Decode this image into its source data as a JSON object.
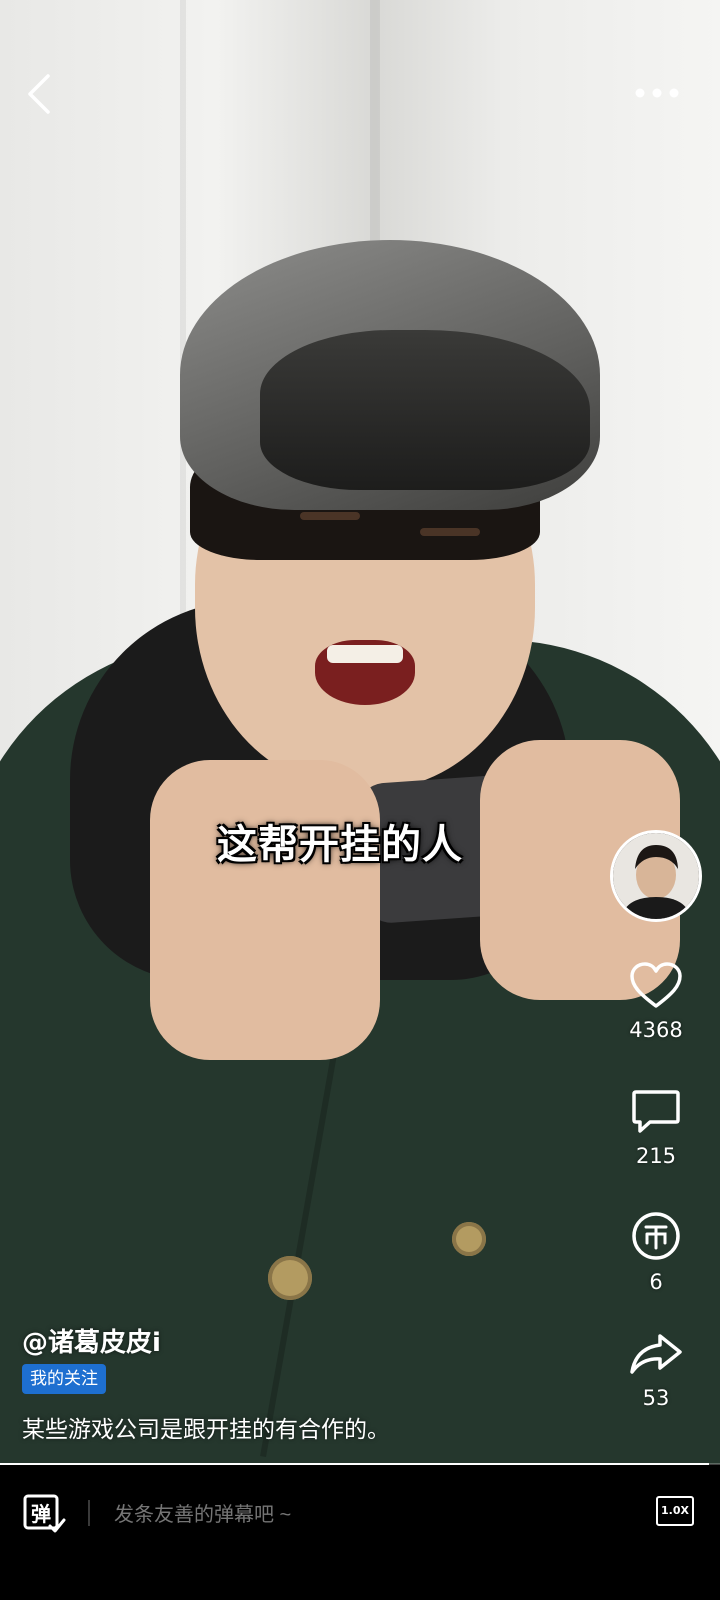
{
  "video": {
    "caption": "这帮开挂的人",
    "progress": 0.985
  },
  "topbar": {
    "back_icon": "chevron-left-icon",
    "more_icon": "more-dots-icon"
  },
  "rail": {
    "avatar_icon": "author-avatar",
    "like": {
      "icon": "heart-icon",
      "count": "4368"
    },
    "comment": {
      "icon": "comment-bubble-icon",
      "count": "215"
    },
    "coin": {
      "icon": "coin-icon",
      "count": "6"
    },
    "share": {
      "icon": "share-arrow-icon",
      "count": "53"
    }
  },
  "info": {
    "author": "@诸葛皮皮i",
    "follow_tag": "我的关注",
    "description": "某些游戏公司是跟开挂的有合作的。"
  },
  "bottom": {
    "danmu_toggle_label": "弹",
    "danmu_placeholder": "发条友善的弹幕吧 ~",
    "speed_label": "1.0X"
  },
  "colors": {
    "tag_blue": "#1e6fd0",
    "background": "#000000"
  }
}
